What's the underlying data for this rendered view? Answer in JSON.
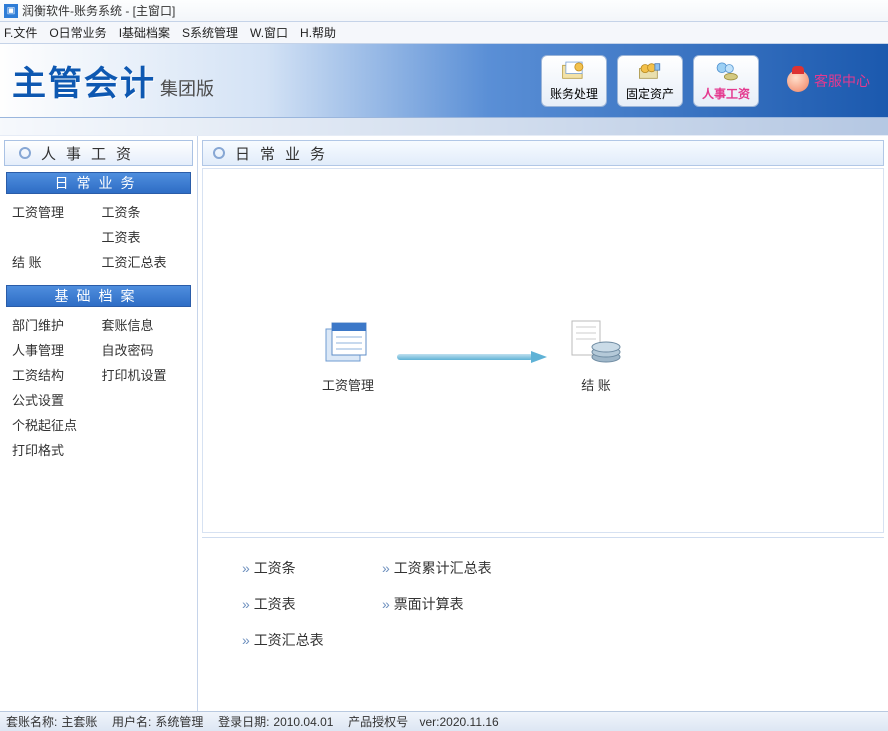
{
  "window": {
    "title": "润衡软件-账务系统 - [主窗口]"
  },
  "menubar": [
    "F.文件",
    "O日常业务",
    "I基础档案",
    "S系统管理",
    "W.窗口",
    "H.帮助"
  ],
  "brand": {
    "main": "主管会计",
    "sub": "集团版"
  },
  "header_buttons": [
    {
      "label": "账务处理"
    },
    {
      "label": "固定资产"
    },
    {
      "label": "人事工资"
    }
  ],
  "support_label": "客服中心",
  "sidebar": {
    "title": "人事工资",
    "groups": [
      {
        "header": "日常业务",
        "items": [
          "工资管理",
          "工资条",
          "",
          "工资表",
          "结 账",
          "工资汇总表"
        ]
      },
      {
        "header": "基础档案",
        "items": [
          "部门维护",
          "套账信息",
          "人事管理",
          "自改密码",
          "工资结构",
          "打印机设置",
          "公式设置",
          "",
          "个税起征点",
          "",
          "打印格式",
          ""
        ]
      }
    ]
  },
  "main": {
    "title": "日常业务",
    "flow": {
      "node1": "工资管理",
      "node2": "结 账"
    },
    "links_col1": [
      "工资条",
      "工资表",
      "工资汇总表"
    ],
    "links_col2": [
      "工资累计汇总表",
      "票面计算表"
    ]
  },
  "statusbar": {
    "account_label": "套账名称:",
    "account_value": "主套账",
    "user_label": "用户名:",
    "user_value": "系统管理",
    "login_label": "登录日期:",
    "login_value": "2010.04.01",
    "lic_label": "产品授权号",
    "lic_value": "ver:2020.11.16"
  }
}
